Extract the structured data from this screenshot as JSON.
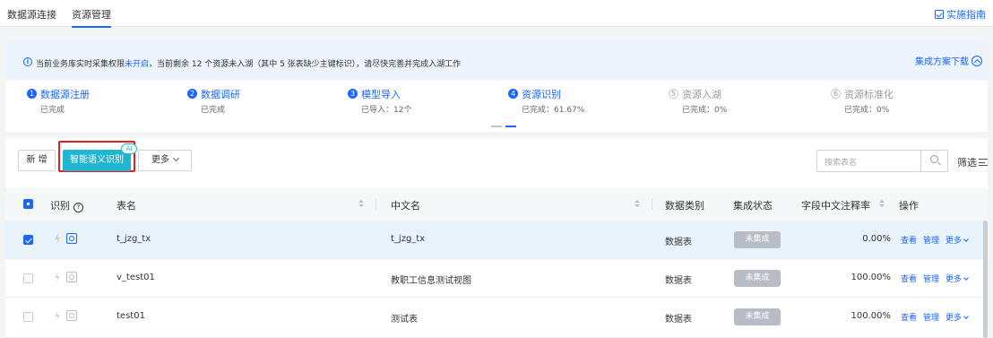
{
  "nav": {
    "tabs": [
      "数据源连接",
      "资源管理"
    ],
    "guide_label": "实施指南"
  },
  "notice": {
    "text_1": "当前业务库实时采集权限",
    "text_highlight": "未开启",
    "text_2": "，当前剩余 12 个资源未入湖（其中 5 张表缺少主键标识），请尽快完善并完成入湖工作",
    "download_label": "集成方案下载"
  },
  "steps": [
    {
      "num": "1",
      "title": "数据源注册",
      "sub": "已完成",
      "done": true
    },
    {
      "num": "2",
      "title": "数据调研",
      "sub": "已完成",
      "done": true
    },
    {
      "num": "3",
      "title": "模型导入",
      "sub": "已导入：12个",
      "done": true
    },
    {
      "num": "4",
      "title": "资源识别",
      "sub": "已完成：61.67%",
      "done": true
    },
    {
      "num": "5",
      "title": "资源入湖",
      "sub": "已完成：0%",
      "done": false
    },
    {
      "num": "6",
      "title": "资源标准化",
      "sub": "已完成：0%",
      "done": false
    }
  ],
  "toolbar": {
    "add_label": "新 增",
    "smart_label": "智能语义识别",
    "ai_badge": "AI",
    "more_label": "更多",
    "search_placeholder": "搜索表名",
    "filter_label": "筛选"
  },
  "table": {
    "headers": {
      "identify": "识别",
      "name": "表名",
      "cn_name": "中文名",
      "category": "数据类别",
      "status": "集成状态",
      "rate": "字段中文注释率",
      "ops": "操作"
    },
    "rows": [
      {
        "name": "t_jzg_tx",
        "cn_name": "t_jzg_tx",
        "category": "数据表",
        "status": "未集成",
        "rate": "0.00%",
        "selected": true
      },
      {
        "name": "v_test01",
        "cn_name": "教职工信息测试视图",
        "category": "数据表",
        "status": "未集成",
        "rate": "100.00%",
        "selected": false
      },
      {
        "name": "test01",
        "cn_name": "测试表",
        "category": "数据表",
        "status": "未集成",
        "rate": "100.00%",
        "selected": false
      }
    ],
    "action_view": "查看",
    "action_manage": "管理",
    "action_more": "更多"
  },
  "colors": {
    "primary": "#1a66ff",
    "smart_button": "#1fb6d2",
    "highlight_box": "#e02020",
    "status_tag": "#b8bcc4"
  }
}
